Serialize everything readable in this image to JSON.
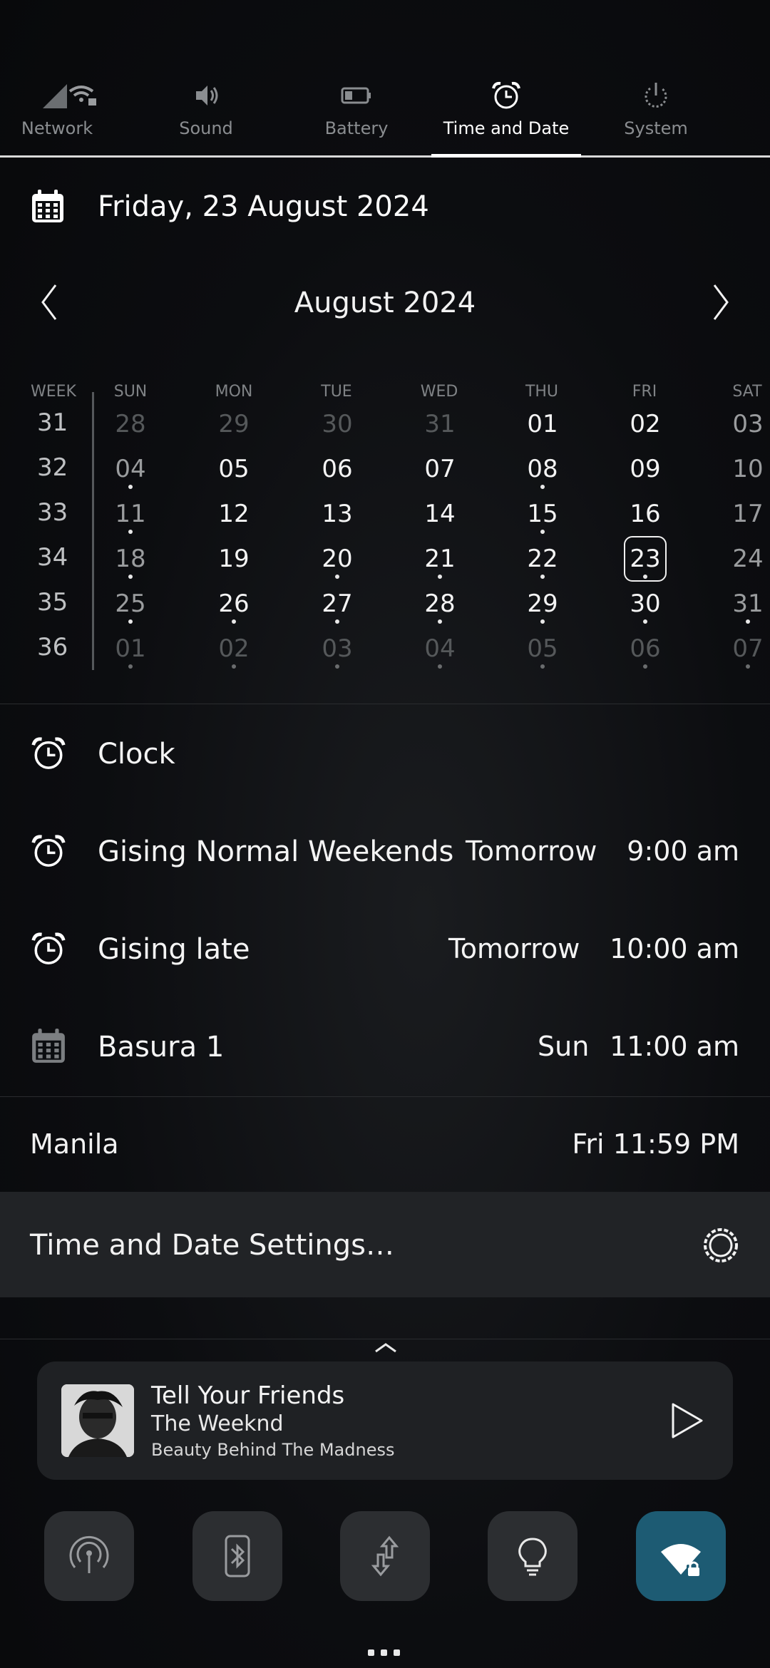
{
  "tabs": [
    {
      "label": "Network",
      "icon": "network-icon"
    },
    {
      "label": "Sound",
      "icon": "speaker-icon"
    },
    {
      "label": "Battery",
      "icon": "battery-icon"
    },
    {
      "label": "Time and Date",
      "icon": "alarm-clock-icon",
      "active": true
    },
    {
      "label": "System",
      "icon": "power-icon"
    }
  ],
  "date_header": {
    "text": "Friday, 23 August 2024"
  },
  "calendar": {
    "month_title": "August 2024",
    "headers": [
      "WEEK",
      "SUN",
      "MON",
      "TUE",
      "WED",
      "THU",
      "FRI",
      "SAT"
    ],
    "weeks": [
      {
        "week": "31",
        "days": [
          "28",
          "29",
          "30",
          "31",
          "01",
          "02",
          "03"
        ]
      },
      {
        "week": "32",
        "days": [
          "04",
          "05",
          "06",
          "07",
          "08",
          "09",
          "10"
        ]
      },
      {
        "week": "33",
        "days": [
          "11",
          "12",
          "13",
          "14",
          "15",
          "16",
          "17"
        ]
      },
      {
        "week": "34",
        "days": [
          "18",
          "19",
          "20",
          "21",
          "22",
          "23",
          "24"
        ]
      },
      {
        "week": "35",
        "days": [
          "25",
          "26",
          "27",
          "28",
          "29",
          "30",
          "31"
        ]
      },
      {
        "week": "36",
        "days": [
          "01",
          "02",
          "03",
          "04",
          "05",
          "06",
          "07"
        ]
      }
    ],
    "today": "23"
  },
  "events": [
    {
      "title": "Clock",
      "day": "",
      "time": "",
      "icon": "alarm-clock-icon"
    },
    {
      "title": "Gising Normal Weekends",
      "day": "Tomorrow",
      "time": "9:00 am",
      "icon": "alarm-clock-icon"
    },
    {
      "title": "Gising late",
      "day": "Tomorrow",
      "time": "10:00 am",
      "icon": "alarm-clock-icon"
    },
    {
      "title": "Basura 1",
      "day": "Sun",
      "time": "11:00 am",
      "icon": "calendar-icon"
    }
  ],
  "timezone": {
    "city": "Manila",
    "time": "Fri 11:59 PM"
  },
  "settings": {
    "label": "Time and Date Settings…"
  },
  "media": {
    "song": "Tell Your Friends",
    "artist": "The Weeknd",
    "album": "Beauty Behind The Madness"
  },
  "quick_toggles": [
    {
      "name": "hotspot",
      "icon": "hotspot-icon",
      "on": false
    },
    {
      "name": "bluetooth",
      "icon": "bluetooth-icon",
      "on": false
    },
    {
      "name": "data-transfer",
      "icon": "data-transfer-icon",
      "on": false
    },
    {
      "name": "flashlight",
      "icon": "lightbulb-icon",
      "on": false
    },
    {
      "name": "wifi",
      "icon": "wifi-lock-icon",
      "on": true
    }
  ],
  "colors": {
    "accent_toggle": "#1d5b73",
    "settings_bg": "#212326"
  }
}
